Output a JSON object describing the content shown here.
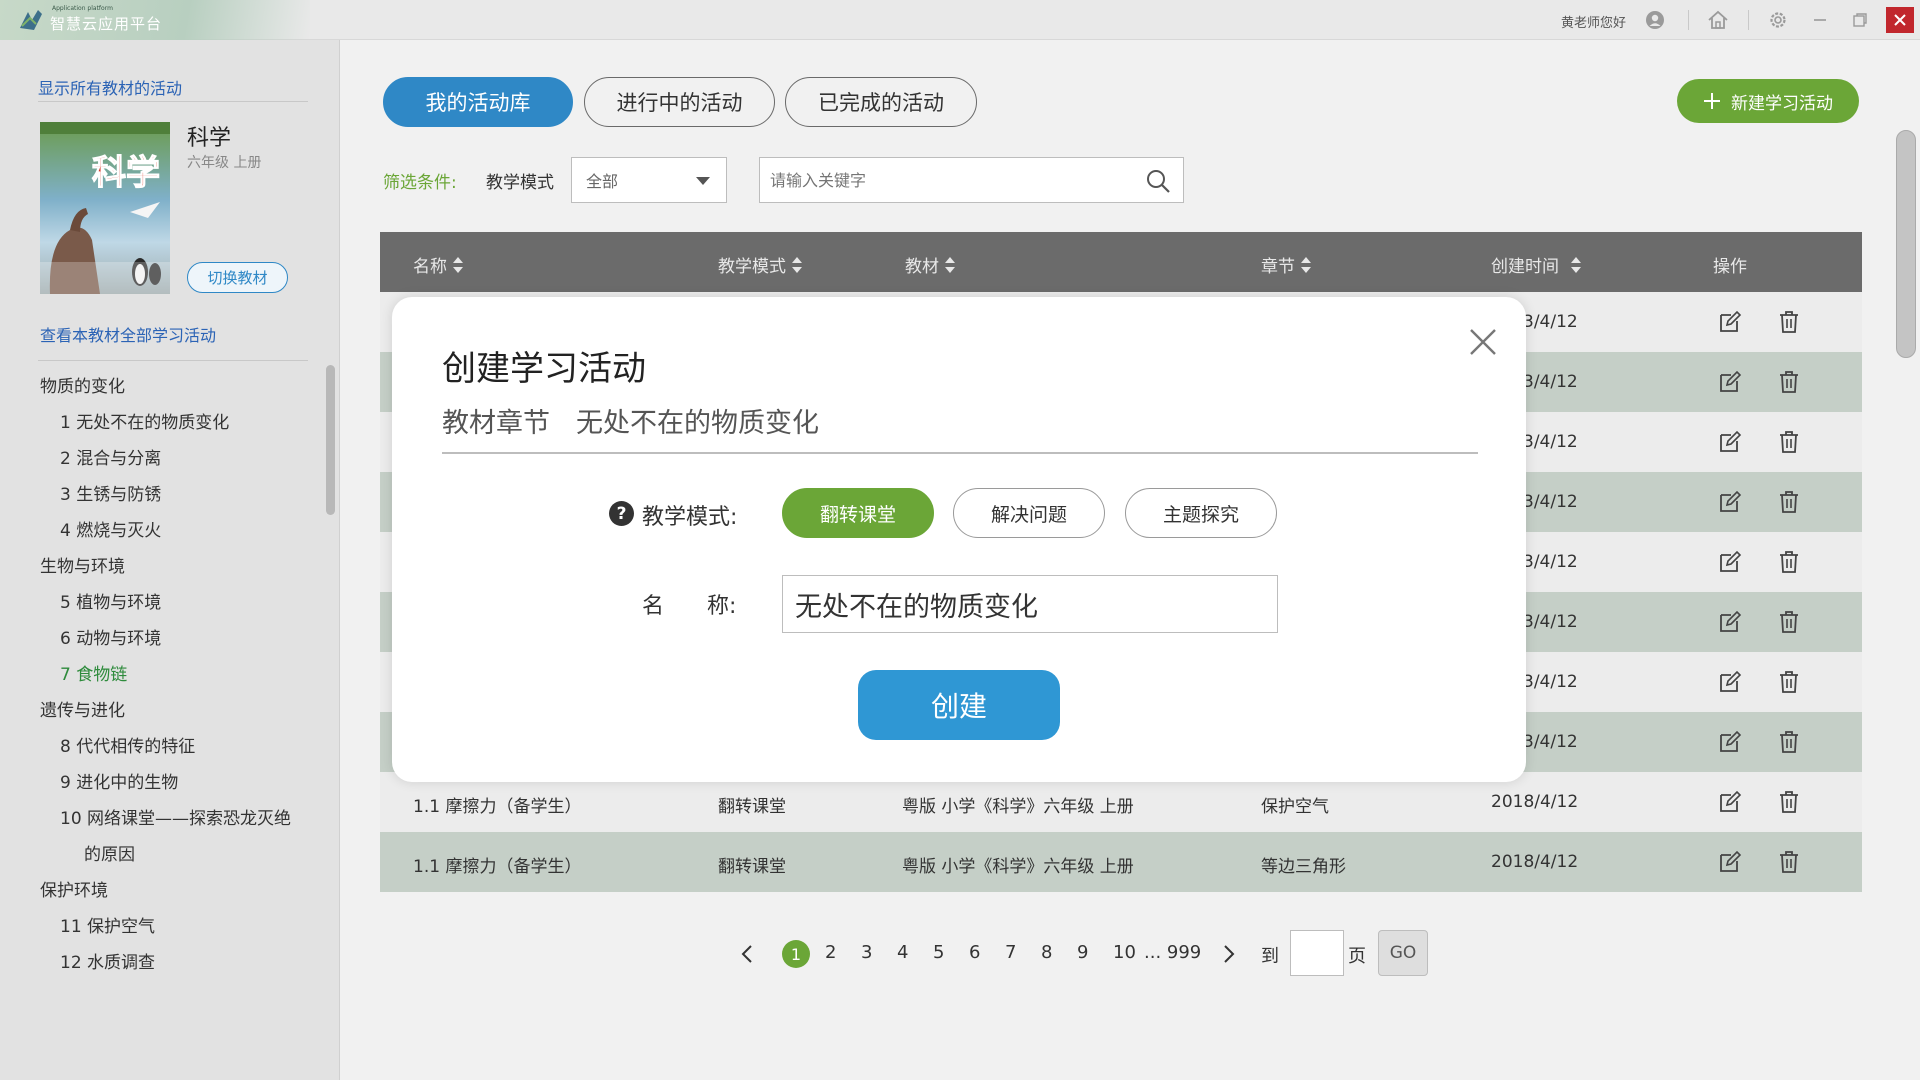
{
  "app": {
    "name": "智慧云应用平台",
    "name_small": "Application platform",
    "greeting": "黄老师您好"
  },
  "sidebar": {
    "show_all_link": "显示所有教材的活动",
    "book_title": "科学",
    "book_subtitle": "六年级 上册",
    "switch_label": "切换教材",
    "view_all_link": "查看本教材全部学习活动",
    "chapters": [
      {
        "label": "物质的变化",
        "level": 0
      },
      {
        "label": "1 无处不在的物质变化",
        "level": 1
      },
      {
        "label": "2 混合与分离",
        "level": 1
      },
      {
        "label": "3 生锈与防锈",
        "level": 1
      },
      {
        "label": "4 燃烧与灭火",
        "level": 1
      },
      {
        "label": "生物与环境",
        "level": 0
      },
      {
        "label": "5 植物与环境",
        "level": 1
      },
      {
        "label": "6 动物与环境",
        "level": 1
      },
      {
        "label": "7 食物链",
        "level": 1,
        "active": true
      },
      {
        "label": "遗传与进化",
        "level": 0
      },
      {
        "label": "8 代代相传的特征",
        "level": 1
      },
      {
        "label": "9 进化中的生物",
        "level": 1
      },
      {
        "label": "10 网络课堂——探索恐龙灭绝",
        "level": 1
      },
      {
        "label": "的原因",
        "level": 2
      },
      {
        "label": "保护环境",
        "level": 0
      },
      {
        "label": "11 保护空气",
        "level": 1
      },
      {
        "label": "12 水质调查",
        "level": 1
      }
    ]
  },
  "tabs": [
    {
      "label": "我的活动库",
      "active": true
    },
    {
      "label": "进行中的活动",
      "active": false
    },
    {
      "label": "已完成的活动",
      "active": false
    }
  ],
  "new_button": "新建学习活动",
  "filter": {
    "label": "筛选条件:",
    "mode_label": "教学模式",
    "mode_value": "全部",
    "search_placeholder": "请输入关键字"
  },
  "table": {
    "headers": [
      "名称",
      "教学模式",
      "教材",
      "章节",
      "创建时间",
      "操作"
    ],
    "hidden_dates": [
      "3/4/12",
      "3/4/12",
      "3/4/12",
      "3/4/12",
      "3/4/12",
      "3/4/12",
      "3/4/12",
      "3/4/12"
    ],
    "rows": [
      {
        "name": "1.1 摩擦力（备学生）",
        "mode": "翻转课堂",
        "book": "粤版 小学《科学》六年级 上册",
        "chapter": "保护空气",
        "date": "2018/4/12"
      },
      {
        "name": "1.1 摩擦力（备学生）",
        "mode": "翻转课堂",
        "book": "粤版 小学《科学》六年级 上册",
        "chapter": "等边三角形",
        "date": "2018/4/12"
      }
    ]
  },
  "pagination": {
    "current": "1",
    "pages": [
      "2",
      "3",
      "4",
      "5",
      "6",
      "7",
      "8",
      "9",
      "10"
    ],
    "ellipsis_last": "... 999",
    "goto_label": "到",
    "page_label": "页",
    "go_label": "GO"
  },
  "modal": {
    "title": "创建学习活动",
    "chapter_label": "教材章节",
    "chapter_value": "无处不在的物质变化",
    "mode_label": "教学模式:",
    "modes": [
      {
        "label": "翻转课堂",
        "selected": true
      },
      {
        "label": "解决问题",
        "selected": false
      },
      {
        "label": "主题探究",
        "selected": false
      }
    ],
    "name_label_1": "名",
    "name_label_2": "称:",
    "name_value": "无处不在的物质变化",
    "create_label": "创建"
  },
  "colors": {
    "primary_blue": "#2f88c6",
    "green": "#6ba637",
    "close_red": "#c1272d",
    "header_gray": "#6b6b6b"
  }
}
